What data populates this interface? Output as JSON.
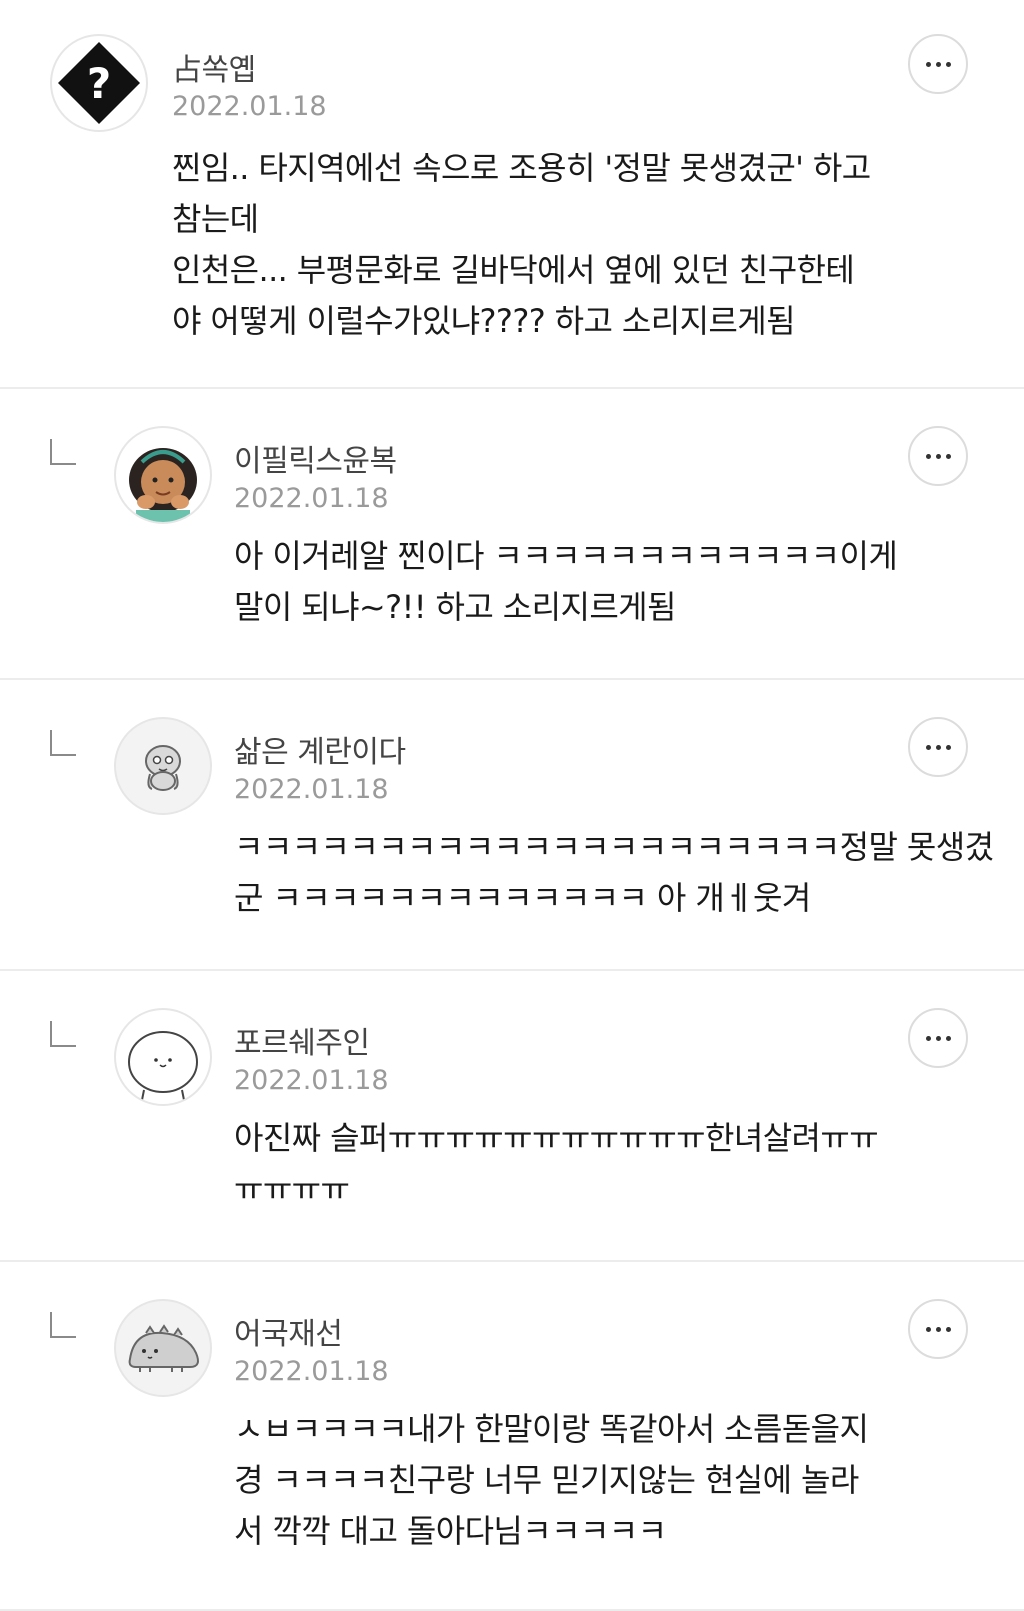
{
  "comments": [
    {
      "author": "占쏙옙",
      "date": "2022.01.18",
      "text": "찐임.. 타지역에선 속으로 조용히 '정말 못생겼군' 하고\n참는데\n인천은... 부평문화로 길바닥에서 옆에 있던 친구한테\n야 어떻게 이럴수가있냐???? 하고 소리지르게됨",
      "avatar_icon": "question-diamond-icon",
      "is_reply": false
    },
    {
      "author": "이필릭스윤복",
      "date": "2022.01.18",
      "text": "아 이거레알 찐이다 ㅋㅋㅋㅋㅋㅋㅋㅋㅋㅋㅋㅋ이게\n말이 되냐~?!! 하고 소리지르게됨",
      "avatar_icon": "cartoon-girl-icon",
      "is_reply": true
    },
    {
      "author": "삶은 계란이다",
      "date": "2022.01.18",
      "text": "ㅋㅋㅋㅋㅋㅋㅋㅋㅋㅋㅋㅋㅋㅋㅋㅋㅋㅋㅋㅋㅋ정말 못생겼\n군 ㅋㅋㅋㅋㅋㅋㅋㅋㅋㅋㅋㅋㅋ 아 개ㅔ웃겨",
      "avatar_icon": "gray-character-icon",
      "is_reply": true
    },
    {
      "author": "포르쉐주인",
      "date": "2022.01.18",
      "text": "아진짜 슬퍼ㅠㅠㅠㅠㅠㅠㅠㅠㅠㅠㅠ한녀살려ㅠㅠ\nㅠㅠㅠㅠ",
      "avatar_icon": "white-blob-icon",
      "is_reply": true
    },
    {
      "author": "어국재선",
      "date": "2022.01.18",
      "text": "ㅅㅂㅋㅋㅋㅋ내가 한말이랑 똑같아서 소름돋을지\n경 ㅋㅋㅋㅋ친구랑 너무 믿기지않는 현실에 놀라\n서 깍깍 대고 돌아다님ㅋㅋㅋㅋㅋ",
      "avatar_icon": "gray-dinosaur-icon",
      "is_reply": true
    }
  ],
  "colors": {
    "divider": "#ececec",
    "author": "#444444",
    "date": "#9a9a9a",
    "text": "#1a1a1a"
  }
}
